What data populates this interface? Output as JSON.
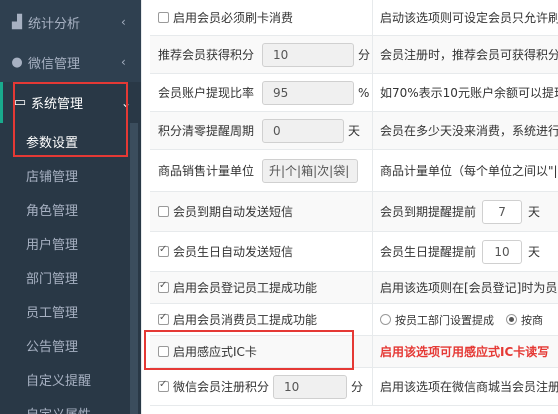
{
  "sidebar": {
    "top_items": [
      {
        "icon": "bar-chart-icon",
        "label": "统计分析",
        "arrow": "‹"
      },
      {
        "icon": "wechat-icon",
        "label": "微信管理",
        "arrow": "‹"
      },
      {
        "icon": "monitor-icon",
        "label": "系统管理",
        "arrow": "⌄"
      }
    ],
    "sub_items": [
      "参数设置",
      "店铺管理",
      "角色管理",
      "用户管理",
      "部门管理",
      "员工管理",
      "公告管理",
      "自定义提醒",
      "自定义属性"
    ]
  },
  "settings": {
    "r0": {
      "label": "启用会员必须刷卡消费",
      "desc": "启动该选项则可设定会员只允许刷"
    },
    "r1": {
      "label": "推荐会员获得积分",
      "value": "10",
      "unit": "分",
      "desc": "会员注册时，推荐会员可获得积分"
    },
    "r2": {
      "label": "会员账户提现比率",
      "value": "95",
      "unit": "%",
      "desc": "如70%表示10元账户余额可以提现"
    },
    "r3": {
      "label": "积分清零提醒周期",
      "value": "0",
      "unit": "天",
      "desc": "会员在多少天没来消费，系统进行"
    },
    "r4": {
      "label": "商品销售计量单位",
      "value": "升|个|箱|次|袋|",
      "desc": "商品计量单位（每个单位之间以\"|"
    },
    "r5": {
      "label": "会员到期自动发送短信",
      "desc_prefix": "会员到期提醒提前",
      "desc_value": "7",
      "desc_unit": "天"
    },
    "r6": {
      "label": "会员生日自动发送短信",
      "desc_prefix": "会员生日提醒提前",
      "desc_value": "10",
      "desc_unit": "天"
    },
    "r7": {
      "label": "启用会员登记员工提成功能",
      "desc": "启用该选项则在[会员登记]时为员工"
    },
    "r8": {
      "label": "启用会员消费员工提成功能",
      "radio1": "按员工部门设置提成",
      "radio2": "按商"
    },
    "r9": {
      "label": "启用感应式IC卡",
      "desc": "启用该选项可用感应式IC卡读写"
    },
    "r10": {
      "label": "微信会员注册积分",
      "value": "10",
      "unit": "分",
      "desc": "启用该选项在微信商城当会员注册"
    }
  }
}
